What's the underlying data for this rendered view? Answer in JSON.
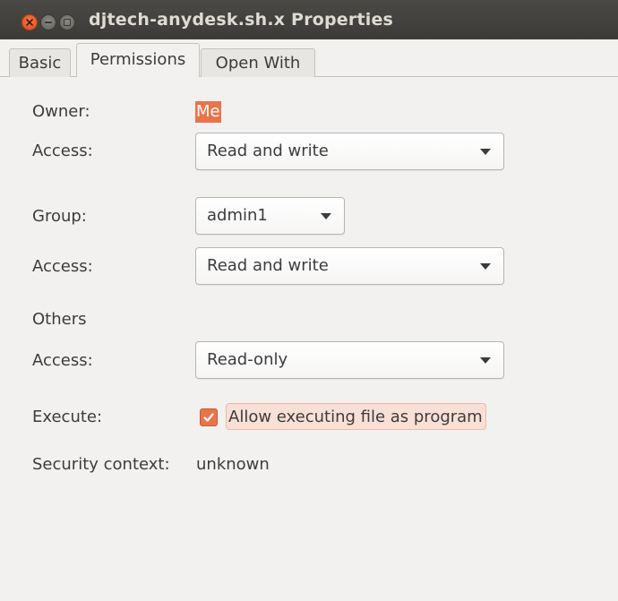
{
  "window": {
    "title": "djtech-anydesk.sh.x Properties"
  },
  "tabs": [
    {
      "label": "Basic",
      "active": false
    },
    {
      "label": "Permissions",
      "active": true
    },
    {
      "label": "Open With",
      "active": false
    }
  ],
  "permissions": {
    "owner": {
      "label": "Owner:",
      "value": "Me"
    },
    "owner_access": {
      "label": "Access:",
      "value": "Read and write"
    },
    "group": {
      "label": "Group:",
      "value": "admin1"
    },
    "group_access": {
      "label": "Access:",
      "value": "Read and write"
    },
    "others": {
      "heading": "Others"
    },
    "others_access": {
      "label": "Access:",
      "value": "Read-only"
    },
    "execute": {
      "label": "Execute:",
      "checkbox_label": "Allow executing file as program",
      "checked": true
    },
    "security_context": {
      "label": "Security context:",
      "value": "unknown"
    }
  },
  "colors": {
    "accent": "#e9734b",
    "titlebar": "#3c3b37",
    "background": "#f2f1f0"
  },
  "icons": {
    "close": "close-icon",
    "minimize": "minimize-icon",
    "maximize": "maximize-icon",
    "dropdown": "chevron-down-icon",
    "check": "checkmark-icon"
  }
}
